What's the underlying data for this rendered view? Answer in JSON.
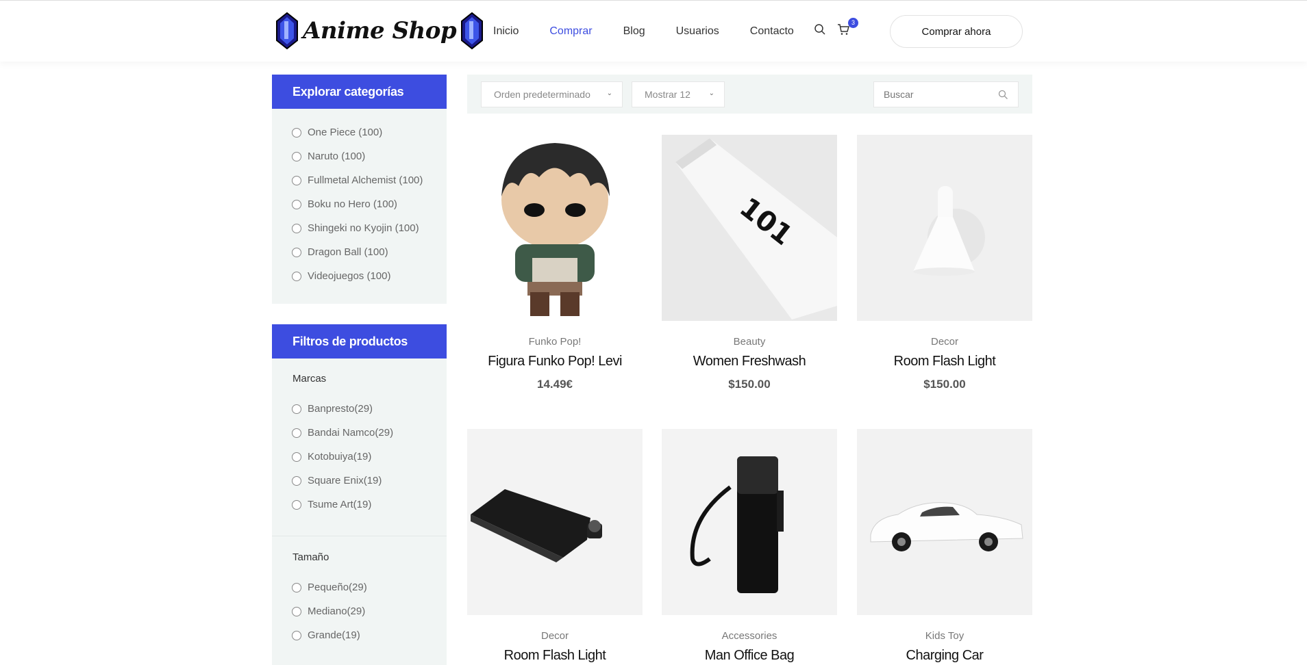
{
  "brand": {
    "logo_text": "Anime Shop"
  },
  "nav": {
    "items": [
      "Inicio",
      "Comprar",
      "Blog",
      "Usuarios",
      "Contacto"
    ],
    "active": "Comprar",
    "cart_count": "3",
    "cta_label": "Comprar ahora"
  },
  "sidebar": {
    "categories": {
      "title": "Explorar categorías",
      "items": [
        "One Piece (100)",
        "Naruto (100)",
        "Fullmetal Alchemist (100)",
        "Boku no Hero (100)",
        "Shingeki no Kyojin (100)",
        "Dragon Ball (100)",
        "Videojuegos (100)"
      ]
    },
    "filters": {
      "title": "Filtros de productos",
      "brands_title": "Marcas",
      "brands": [
        "Banpresto(29)",
        "Bandai Namco(29)",
        "Kotobuiya(19)",
        "Square Enix(19)",
        "Tsume Art(19)"
      ],
      "size_title": "Tamaño",
      "sizes": [
        "Pequeño(29)",
        "Mediano(29)",
        "Grande(19)"
      ]
    }
  },
  "toolbar": {
    "sort_value": "Orden predeterminado",
    "show_value": "Mostrar 12",
    "search_placeholder": "Buscar"
  },
  "products": [
    {
      "category": "Funko Pop!",
      "name": "Figura Funko Pop! Levi",
      "price": "14.49€",
      "icon": "funko-figure"
    },
    {
      "category": "Beauty",
      "name": "Women Freshwash",
      "price": "$150.00",
      "icon": "tube"
    },
    {
      "category": "Decor",
      "name": "Room Flash Light",
      "price": "$150.00",
      "icon": "wall-lamp"
    },
    {
      "category": "Decor",
      "name": "Room Flash Light",
      "price": "",
      "icon": "flask"
    },
    {
      "category": "Accessories",
      "name": "Man Office Bag",
      "price": "",
      "icon": "backpack"
    },
    {
      "category": "Kids Toy",
      "name": "Charging Car",
      "price": "",
      "icon": "car"
    }
  ],
  "colors": {
    "accent": "#3d4de0",
    "sidebar_bg": "#f1f5f4"
  }
}
